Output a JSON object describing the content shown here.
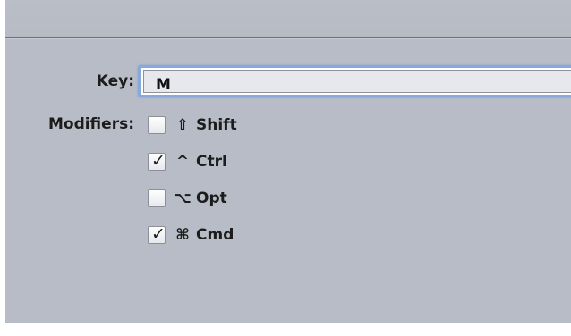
{
  "shortcut_panel": {
    "key": {
      "label": "Key:",
      "value": "M"
    },
    "modifiers": {
      "label": "Modifiers:",
      "items": [
        {
          "name": "shift",
          "symbol": "⇧",
          "label": "Shift",
          "checked": false
        },
        {
          "name": "ctrl",
          "symbol": "^",
          "label": "Ctrl",
          "checked": true
        },
        {
          "name": "opt",
          "symbol": "⌥",
          "label": "Opt",
          "checked": false
        },
        {
          "name": "cmd",
          "symbol": "⌘",
          "label": "Cmd",
          "checked": true
        }
      ]
    },
    "checkmark_glyph": "✓",
    "colors": {
      "panel_background": "#b7bcc6",
      "focus_ring": "#87a9dc",
      "field_fill": "#e6e8ee"
    }
  }
}
